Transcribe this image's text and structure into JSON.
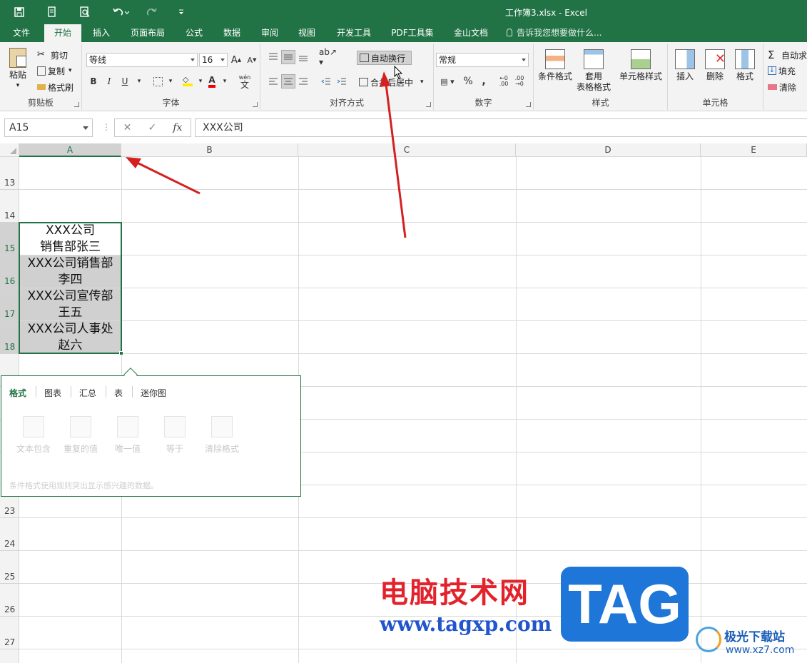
{
  "window": {
    "title": "工作簿3.xlsx - Excel",
    "accent_color": "#217346"
  },
  "quick_access": {
    "icons": [
      "save-icon",
      "print-preview-icon",
      "zoom-preview-icon",
      "undo-icon",
      "redo-icon",
      "customize-icon"
    ]
  },
  "tabs": [
    "文件",
    "开始",
    "插入",
    "页面布局",
    "公式",
    "数据",
    "审阅",
    "视图",
    "开发工具",
    "PDF工具集",
    "金山文档"
  ],
  "active_tab": "开始",
  "tell_me": "告诉我您想要做什么...",
  "ribbon": {
    "clipboard": {
      "label": "剪贴板",
      "paste": "粘贴",
      "cut": "剪切",
      "copy": "复制",
      "format_painter": "格式刷"
    },
    "font": {
      "label": "字体",
      "font_name": "等线",
      "font_size": "16",
      "bold": "B",
      "italic": "I",
      "underline": "U",
      "wen": "wén",
      "wen2": "文",
      "font_color_letter": "A"
    },
    "alignment": {
      "label": "对齐方式",
      "wrap_text": "自动换行",
      "merge_center": "合并后居中"
    },
    "number": {
      "label": "数字",
      "format": "常规",
      "percent": "%",
      "comma": ","
    },
    "styles": {
      "label": "样式",
      "conditional": "条件格式",
      "table_format_1": "套用",
      "table_format_2": "表格格式",
      "cell_styles": "单元格样式"
    },
    "cells": {
      "label": "单元格",
      "insert": "插入",
      "delete": "删除",
      "format": "格式"
    },
    "editing": {
      "autosum": "自动求",
      "fill": "填充",
      "clear": "清除"
    }
  },
  "formula_bar": {
    "name_box": "A15",
    "formula": "XXX公司",
    "fx": "fx"
  },
  "columns": [
    "A",
    "B",
    "C",
    "D",
    "E"
  ],
  "rows": [
    "13",
    "14",
    "15",
    "16",
    "17",
    "18",
    "23",
    "24",
    "25",
    "26",
    "27"
  ],
  "cells": {
    "a15": [
      "XXX公司",
      "销售部张三"
    ],
    "a16": [
      "XXX公司销售部",
      "李四"
    ],
    "a17": [
      "XXX公司宣传部",
      "王五"
    ],
    "a18": [
      "XXX公司人事处",
      "赵六"
    ]
  },
  "quick_analysis": {
    "tabs": [
      "格式",
      "图表",
      "汇总",
      "表",
      "迷你图"
    ],
    "items": [
      "文本包含",
      "重复的值",
      "唯一值",
      "等于",
      "清除格式"
    ],
    "description": "条件格式使用规则突出显示感兴趣的数据。"
  },
  "watermark": {
    "cn": "电脑技术网",
    "url": "www.tagxp.com",
    "tag": "TAG",
    "site": "极光下载站",
    "site_url": "www.xz7.com"
  }
}
